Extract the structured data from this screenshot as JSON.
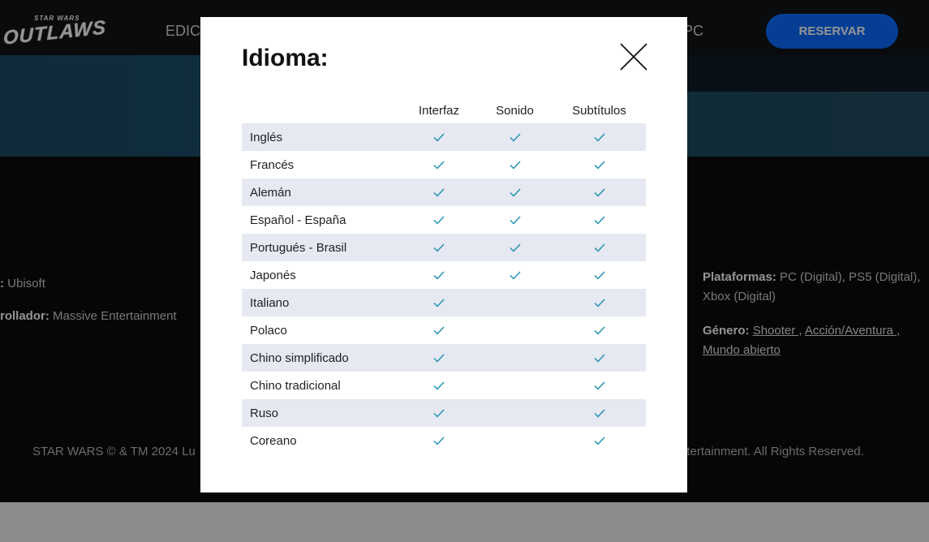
{
  "background": {
    "logo": {
      "small": "STAR WARS",
      "big": "OUTLAWS"
    },
    "nav": {
      "left_link": "EDICI",
      "right_link": "PC"
    },
    "reserve_label": "RESERVAR",
    "info": {
      "publisher_label": ":",
      "publisher_value": "Ubisoft",
      "developer_label": "rollador:",
      "developer_value": "Massive Entertainment",
      "platforms_label": "Plataformas:",
      "platforms_value": "PC (Digital), PS5 (Digital), Xbox (Digital)",
      "genre_label": "Género:",
      "genres": [
        "Shooter ,",
        "Acción/Aventura ,",
        "Mundo abierto"
      ]
    },
    "footer": {
      "left": "STAR WARS © & TM 2024 Lu",
      "right": "ntertainment. All Rights Reserved."
    }
  },
  "modal": {
    "title": "Idioma:",
    "columns": [
      "Interfaz",
      "Sonido",
      "Subtítulos"
    ],
    "rows": [
      {
        "language": "Inglés",
        "interface": true,
        "audio": true,
        "subtitles": true
      },
      {
        "language": "Francés",
        "interface": true,
        "audio": true,
        "subtitles": true
      },
      {
        "language": "Alemán",
        "interface": true,
        "audio": true,
        "subtitles": true
      },
      {
        "language": "Español - España",
        "interface": true,
        "audio": true,
        "subtitles": true
      },
      {
        "language": "Portugués - Brasil",
        "interface": true,
        "audio": true,
        "subtitles": true
      },
      {
        "language": "Japonés",
        "interface": true,
        "audio": true,
        "subtitles": true
      },
      {
        "language": "Italiano",
        "interface": true,
        "audio": false,
        "subtitles": true
      },
      {
        "language": "Polaco",
        "interface": true,
        "audio": false,
        "subtitles": true
      },
      {
        "language": "Chino simplificado",
        "interface": true,
        "audio": false,
        "subtitles": true
      },
      {
        "language": "Chino tradicional",
        "interface": true,
        "audio": false,
        "subtitles": true
      },
      {
        "language": "Ruso",
        "interface": true,
        "audio": false,
        "subtitles": true
      },
      {
        "language": "Coreano",
        "interface": true,
        "audio": false,
        "subtitles": true
      }
    ],
    "check_icon": "check-icon",
    "close_icon": "close-icon"
  },
  "colors": {
    "accent": "#0a6cff",
    "check": "#1a8fb0",
    "row_stripe": "#e6e8f2"
  }
}
